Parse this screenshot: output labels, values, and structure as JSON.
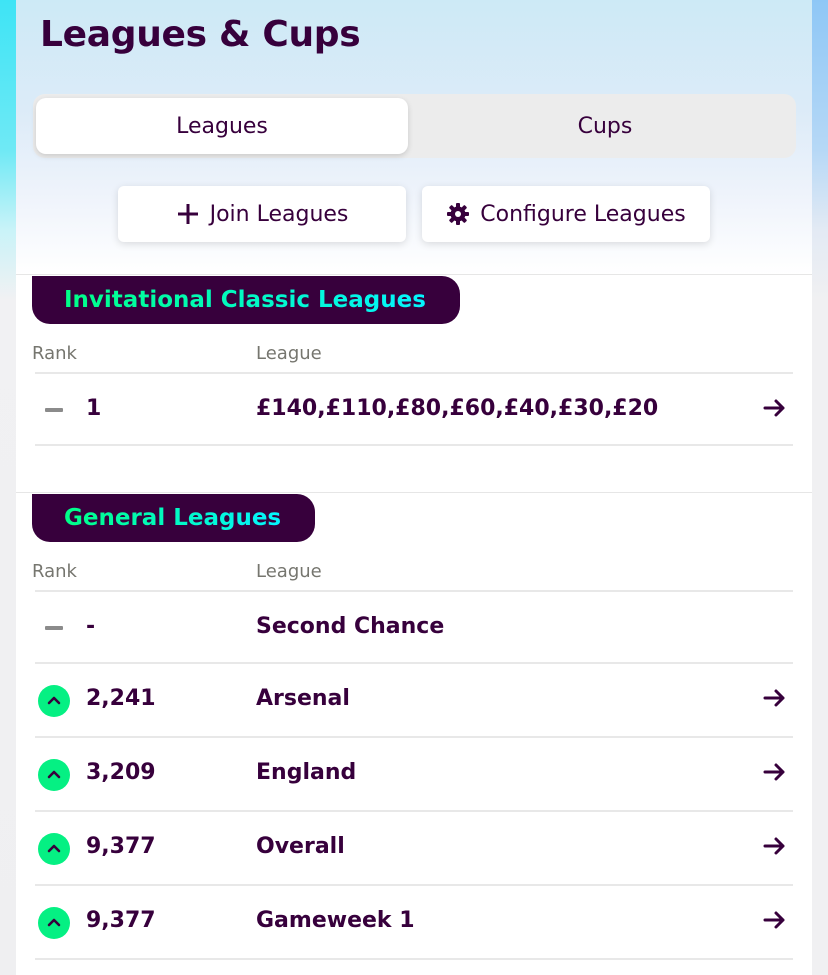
{
  "page": {
    "title": "Leagues & Cups"
  },
  "tabs": [
    {
      "label": "Leagues",
      "active": true
    },
    {
      "label": "Cups",
      "active": false
    }
  ],
  "actions": {
    "join_label": "Join Leagues",
    "join_icon": "plus-icon",
    "configure_label": "Configure Leagues",
    "configure_icon": "gear-icon"
  },
  "colors": {
    "brand": "#37003c",
    "accent_green": "#00ff87",
    "accent_cyan": "#04f5ff",
    "movement_up": "#05f083"
  },
  "sections": [
    {
      "title": "Invitational Classic Leagues",
      "columns": {
        "rank": "Rank",
        "league": "League"
      },
      "rows": [
        {
          "movement": "same",
          "rank": "1",
          "league": "£140,£110,£80,£60,£40,£30,£20",
          "has_arrow": true
        }
      ]
    },
    {
      "title": "General Leagues",
      "columns": {
        "rank": "Rank",
        "league": "League"
      },
      "rows": [
        {
          "movement": "same",
          "rank": "-",
          "league": "Second Chance",
          "has_arrow": false
        },
        {
          "movement": "up",
          "rank": "2,241",
          "league": "Arsenal",
          "has_arrow": true
        },
        {
          "movement": "up",
          "rank": "3,209",
          "league": "England",
          "has_arrow": true
        },
        {
          "movement": "up",
          "rank": "9,377",
          "league": "Overall",
          "has_arrow": true
        },
        {
          "movement": "up",
          "rank": "9,377",
          "league": "Gameweek 1",
          "has_arrow": true
        }
      ]
    }
  ]
}
